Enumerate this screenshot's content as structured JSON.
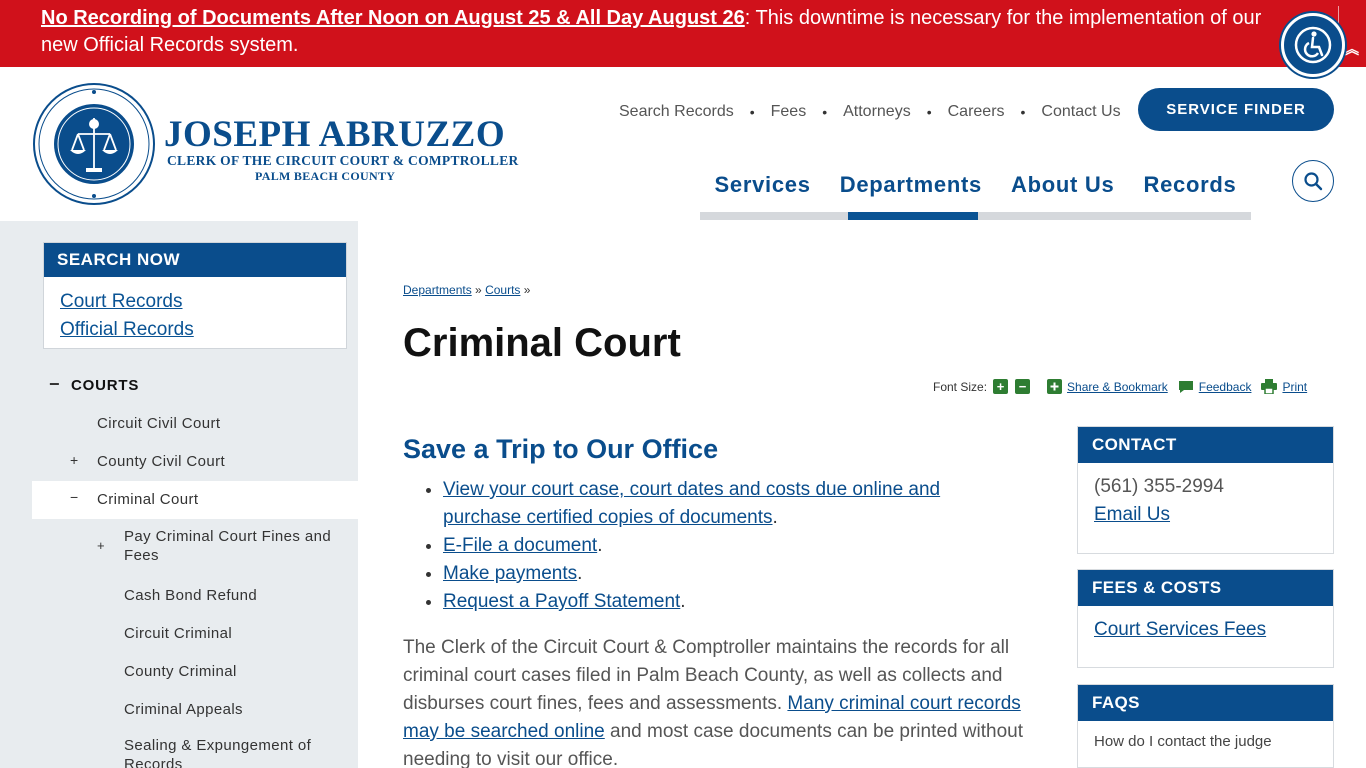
{
  "alert": {
    "link_text": "No Recording of Documents After Noon on August 25 & All Day August 26",
    "message": ": This downtime is necessary for the implementation of our new Official Records system."
  },
  "brand": {
    "name": "JOSEPH ABRUZZO",
    "subtitle": "CLERK OF THE CIRCUIT COURT & COMPTROLLER",
    "county": "PALM BEACH COUNTY",
    "seal_text": "CLERK OF THE CIRCUIT COURT & COMPTROLLER • PALM BEACH COUNTY"
  },
  "utility_nav": [
    "Search Records",
    "Fees",
    "Attorneys",
    "Careers",
    "Contact Us"
  ],
  "service_finder_label": "SERVICE FINDER",
  "main_nav": [
    "Services",
    "Departments",
    "About Us",
    "Records"
  ],
  "sidebar": {
    "search_heading": "SEARCH NOW",
    "search_links": [
      "Court Records",
      "Official Records"
    ],
    "section": "COURTS",
    "items": [
      {
        "label": "Circuit Civil Court",
        "toggle": ""
      },
      {
        "label": "County Civil Court",
        "toggle": "+"
      },
      {
        "label": "Criminal Court",
        "toggle": "−"
      }
    ],
    "subitems": [
      {
        "label": "Pay Criminal Court Fines and Fees",
        "toggle": "+"
      },
      {
        "label": "Cash Bond Refund",
        "toggle": ""
      },
      {
        "label": "Circuit Criminal",
        "toggle": ""
      },
      {
        "label": "County Criminal",
        "toggle": ""
      },
      {
        "label": "Criminal Appeals",
        "toggle": ""
      },
      {
        "label": "Sealing & Expungement of Records",
        "toggle": ""
      }
    ]
  },
  "breadcrumb": {
    "items": [
      "Departments",
      "Courts"
    ],
    "separator": "»"
  },
  "page_title": "Criminal Court",
  "tools": {
    "font_size_label": "Font Size:",
    "increase": "+",
    "decrease": "−",
    "share": "Share & Bookmark",
    "feedback": "Feedback",
    "print": "Print"
  },
  "content": {
    "heading": "Save a Trip to Our Office",
    "list": [
      "View your court case, court dates and costs due online and purchase certified copies of documents",
      "E-File a document",
      "Make payments",
      "Request a Payoff Statement"
    ],
    "intro_before": "The Clerk of the Circuit Court & Comptroller maintains the records for all criminal court cases filed in Palm Beach County, as well as collects and disburses court fines, fees and assessments. ",
    "intro_link": "Many criminal court records may be searched online",
    "intro_after": " and most case documents can be printed without needing to visit our office."
  },
  "right": {
    "contact": {
      "heading": "CONTACT",
      "phone": "(561) 355-2994",
      "email": "Email Us"
    },
    "fees": {
      "heading": "FEES & COSTS",
      "link": "Court Services Fees"
    },
    "faqs": {
      "heading": "FAQS",
      "text": "How do I contact the judge"
    }
  },
  "colors": {
    "alert": "#d0111b",
    "brand_blue": "#0a4d8c",
    "sidebar_bg": "#e8ecef",
    "tool_green": "#2e7d32"
  }
}
